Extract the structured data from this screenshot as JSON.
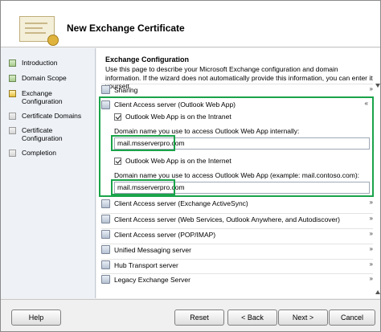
{
  "window": {
    "title": "New Exchange Certificate"
  },
  "nav": {
    "items": [
      {
        "label": "Introduction",
        "state": "done"
      },
      {
        "label": "Domain Scope",
        "state": "done"
      },
      {
        "label": "Exchange Configuration",
        "state": "active"
      },
      {
        "label": "Certificate Domains",
        "state": "pending"
      },
      {
        "label": "Certificate Configuration",
        "state": "pending"
      },
      {
        "label": "Completion",
        "state": "pending"
      }
    ]
  },
  "main": {
    "section_title": "Exchange Configuration",
    "description": "Use this page to describe your Microsoft Exchange configuration and domain information. If the wizard does not automatically provide this information, you can enter it yourself.",
    "sections": {
      "sharing": "Sharing",
      "owa": "Client Access server (Outlook Web App)",
      "activesync": "Client Access server (Exchange ActiveSync)",
      "webservices": "Client Access server (Web Services, Outlook Anywhere, and Autodiscover)",
      "popimap": "Client Access server (POP/IMAP)",
      "um": "Unified Messaging server",
      "hub": "Hub Transport server",
      "legacy": "Legacy Exchange Server"
    },
    "owa": {
      "intranet_checkbox": "Outlook Web App is on the Intranet",
      "intranet_label": "Domain name you use to access Outlook Web App internally:",
      "intranet_value": "mail.msserverpro.com",
      "internet_checkbox": "Outlook Web App is on the Internet",
      "internet_label": "Domain name you use to access Outlook Web App (example: mail.contoso.com):",
      "internet_value": "mail.msserverpro.com"
    },
    "chevrons": {
      "collapsed": "»",
      "expanded": "«"
    }
  },
  "footer": {
    "help": "Help",
    "reset": "Reset",
    "back": "< Back",
    "next": "Next >",
    "cancel": "Cancel"
  },
  "colors": {
    "highlight": "#1aa34a"
  },
  "icons": [
    "certificate-icon",
    "server-icon",
    "checkmark-icon",
    "chevron-icon"
  ]
}
